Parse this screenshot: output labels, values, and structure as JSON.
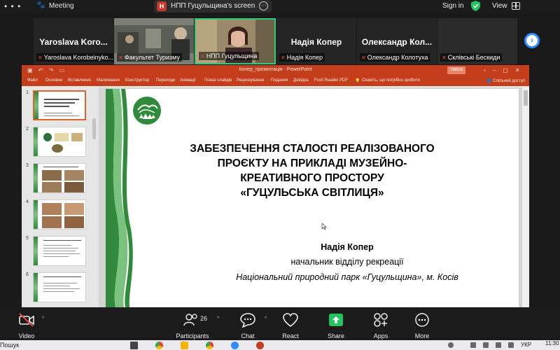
{
  "zoom": {
    "meeting_label": "Meeting",
    "share_badge": "Н",
    "share_title": "НПП Гуцульщина's screen",
    "more_glyph": "···",
    "signin_label": "Sign in",
    "view_label": "View"
  },
  "participants": [
    {
      "big": "Yaroslava  Koro...",
      "small": "Yaroslava Korobeinyko..."
    },
    {
      "big": "",
      "small": "Факультет Туризму"
    },
    {
      "big": "",
      "small": "НПП Гуцульщина"
    },
    {
      "big": "Надія Копер",
      "small": "Надія Копер"
    },
    {
      "big": "Олександр  Кол...",
      "small": "Олександр Колотуха"
    },
    {
      "big": "",
      "small": "Склівські Бескиди"
    }
  ],
  "ppt": {
    "window_title": "Копер_презентація  ·  PowerPoint",
    "account_btn": "Увійти",
    "ribbon_tabs": [
      "Файл",
      "Основне",
      "Вставлення",
      "Малювання",
      "Конструктор",
      "Переходи",
      "Анімації",
      "Показ слайдів",
      "Рецензування",
      "Подання",
      "Довідка",
      "Foxit Reader PDF",
      "Скажіть, що потрібно зробити"
    ],
    "share_label": "Спільний доступ",
    "thumb_numbers": [
      "1",
      "2",
      "3",
      "4",
      "5",
      "6"
    ],
    "slide": {
      "title_lines": [
        "ЗАБЕЗПЕЧЕННЯ СТАЛОСТІ РЕАЛІЗОВАНОГО",
        "ПРОЄКТУ НА ПРИКЛАДІ МУЗЕЙНО-",
        "КРЕАТИВНОГО ПРОСТОРУ",
        "«ГУЦУЛЬСЬКА СВІТЛИЦЯ»"
      ],
      "author": "Надія Копер",
      "role": "начальник відділу рекреації",
      "org": "Національний природний парк «Гуцульщина», м. Косів"
    }
  },
  "toolbar": {
    "video": "Video",
    "participants": "Participants",
    "participants_count": "26",
    "chat": "Chat",
    "react": "React",
    "share": "Share",
    "apps": "Apps",
    "more": "More"
  },
  "taskbar": {
    "search": "Пошук",
    "lang": "УКР",
    "time": "11:30"
  },
  "colors": {
    "ppt_accent": "#c43e1c",
    "share_green": "#22c55e",
    "zoom_blue": "#2d8cff",
    "slide_green": "#2f8a3b"
  }
}
